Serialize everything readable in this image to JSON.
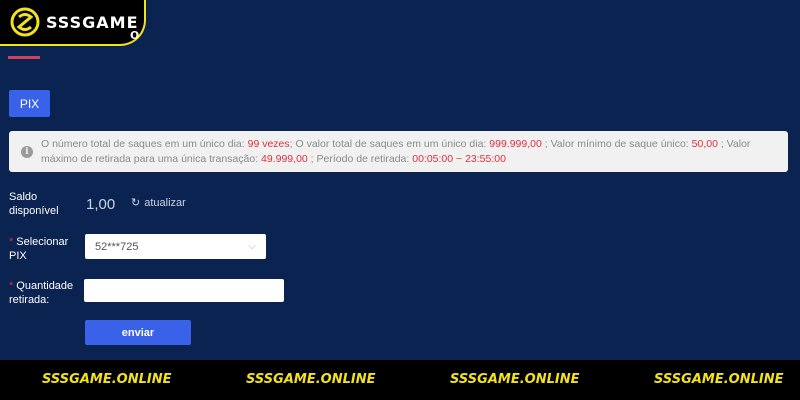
{
  "brand": {
    "name": "SSSGAME",
    "accent": "#f2e21a"
  },
  "header": {
    "partial_title": "o"
  },
  "tabs": {
    "pix_label": "PIX"
  },
  "notice": {
    "icon": "info-icon",
    "t1": "O número total de saques em um único dia: ",
    "v1": "99 vezes",
    "t2": ";   O valor total de saques em um único dia: ",
    "v2": "999.999,00",
    "t3": " ;   Valor mínimo de saque único: ",
    "v3": "50,00",
    "t4": " ;   Valor máximo de retirada para uma única transação: ",
    "v4": "49.999,00",
    "t5": " ; Período de retirada: ",
    "v5": "00:05:00 ~ 23:55:00"
  },
  "form": {
    "balance_label": "Saldo disponível",
    "balance_value": "1,00",
    "refresh_label": "atualizar",
    "required_mark": "*",
    "select_label": "Selecionar PIX",
    "select_value": "52***725",
    "amount_label": "Quantidade retirada:",
    "amount_value": "",
    "submit_label": "enviar"
  },
  "footer": {
    "items": [
      "SSSGAME.ONLINE",
      "SSSGAME.ONLINE",
      "SSSGAME.ONLINE",
      "SSSGAME.ONLINE"
    ]
  }
}
